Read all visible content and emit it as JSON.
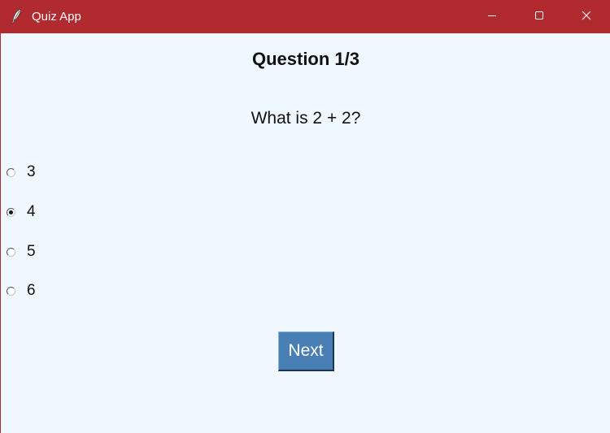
{
  "window": {
    "title": "Quiz App",
    "icon": "feather-icon",
    "titlebar_color": "#b02a30",
    "controls": [
      "minimize-icon",
      "maximize-icon",
      "close-icon"
    ]
  },
  "quiz": {
    "header": "Question 1/3",
    "question": "What is 2 + 2?",
    "options": [
      {
        "label": "3",
        "selected": false
      },
      {
        "label": "4",
        "selected": true
      },
      {
        "label": "5",
        "selected": false
      },
      {
        "label": "6",
        "selected": false
      }
    ],
    "next_label": "Next"
  },
  "colors": {
    "background": "#f0f8ff",
    "button": "#4a7fb5",
    "button_text": "#ffffff"
  }
}
